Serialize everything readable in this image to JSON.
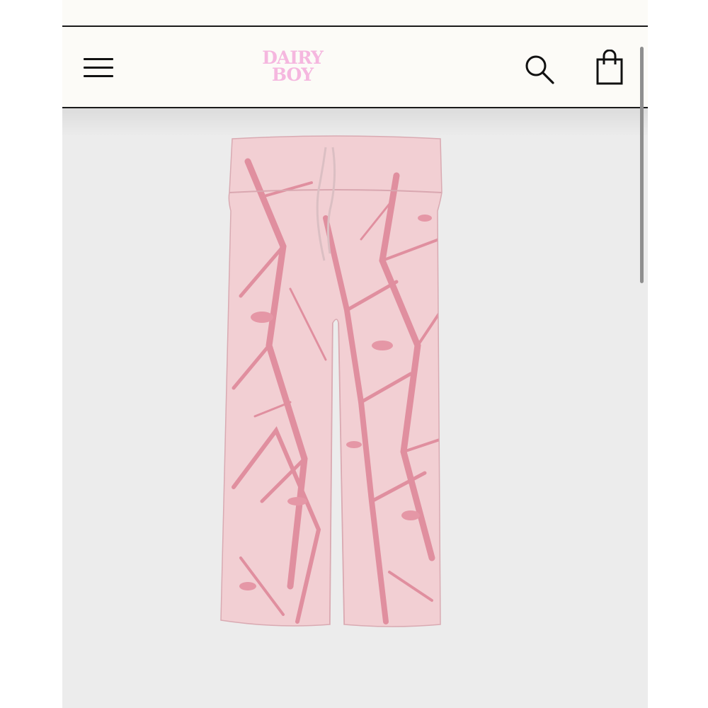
{
  "header": {
    "logo": {
      "line1": "DAIRY",
      "line2": "BOY",
      "color": "#f5b7df"
    },
    "menu_icon": "hamburger-icon",
    "search_icon": "search-icon",
    "cart_icon": "shopping-bag-icon"
  },
  "product": {
    "image_subject": "pink-camo-print-sweatpants",
    "colors": {
      "base": "#f2cfd3",
      "print": "#e08f9f"
    }
  },
  "colors": {
    "header_bg": "#fcfbf7",
    "page_bg": "#ececec",
    "divider": "#1a1a1a"
  }
}
